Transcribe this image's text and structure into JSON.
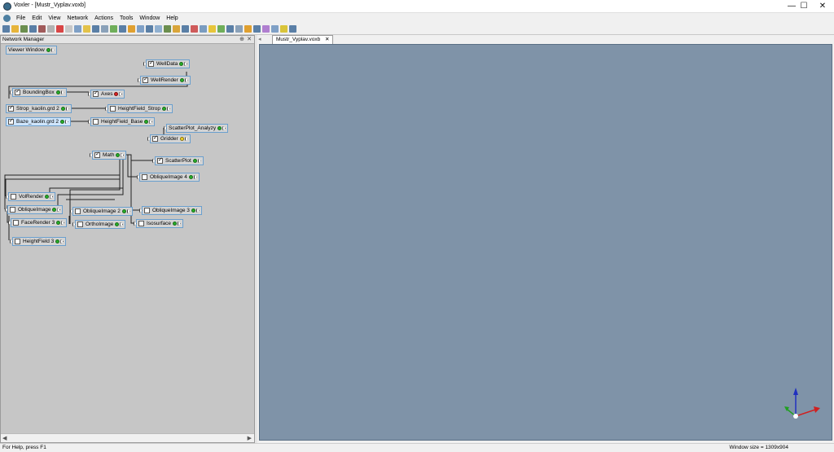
{
  "window": {
    "title": "Voxler - [Mustr_Vyplav.voxb]",
    "minimize": "—",
    "maximize": "☐",
    "close": "✕"
  },
  "menu": [
    "File",
    "Edit",
    "View",
    "Network",
    "Actions",
    "Tools",
    "Window",
    "Help"
  ],
  "toolbar_colors": [
    "#5a7fa6",
    "#e7b43a",
    "#6b8e4e",
    "#5a7fa6",
    "#a05a5a",
    "#b2b2b2",
    "#d94545",
    "#c8c8c8",
    "#7fa0c6",
    "#e3c24a",
    "#5a7fa6",
    "#8aa1b9",
    "#6fae5a",
    "#5a7fa6",
    "#e0a030",
    "#7fa0c6",
    "#5a7fa6",
    "#90b0d0",
    "#6b8e4e",
    "#d9a53a",
    "#5a7fa6",
    "#cf5b5b",
    "#7a9cc0",
    "#e7c53a",
    "#6fae5a",
    "#5a7fa6",
    "#8aa1b9",
    "#e0a030",
    "#5a7fa6",
    "#b07fd0",
    "#7fa0c6",
    "#d9c43a",
    "#5a7fa6"
  ],
  "network_manager": {
    "title": "Network Manager",
    "pin": "⊕",
    "close": "✕",
    "scroll_left": "◀",
    "scroll_right": "▶",
    "nodes": [
      {
        "id": "viewer-window",
        "label": "Viewer Window",
        "checkbox": false,
        "checked": false,
        "port": "green"
      },
      {
        "id": "welldata",
        "label": "WellData",
        "checkbox": true,
        "checked": true,
        "port": "green"
      },
      {
        "id": "wellrender",
        "label": "WellRender",
        "checkbox": true,
        "checked": true,
        "port": "green"
      },
      {
        "id": "boundingbox",
        "label": "BoundingBox",
        "checkbox": true,
        "checked": true,
        "port": "green"
      },
      {
        "id": "axes",
        "label": "Axes",
        "checkbox": true,
        "checked": true,
        "port": "red"
      },
      {
        "id": "strop-kaolin",
        "label": "Strop_kaolin.grd 2",
        "checkbox": true,
        "checked": true,
        "port": "green"
      },
      {
        "id": "heightfield-strop",
        "label": "HeightField_Strop",
        "checkbox": true,
        "checked": false,
        "port": "green"
      },
      {
        "id": "baze-kaolin",
        "label": "Baze_kaolin.grd 2",
        "checkbox": true,
        "checked": true,
        "port": "green"
      },
      {
        "id": "heightfield-base",
        "label": "HeightField_Base",
        "checkbox": true,
        "checked": false,
        "port": "green"
      },
      {
        "id": "scatterplot-analyzy",
        "label": "ScatterPlot_Analyzy",
        "checkbox": false,
        "checked": false,
        "port": "green"
      },
      {
        "id": "gridder",
        "label": "Gridder",
        "checkbox": true,
        "checked": true,
        "port": "yellow"
      },
      {
        "id": "math",
        "label": "Math",
        "checkbox": true,
        "checked": true,
        "port": "green"
      },
      {
        "id": "scatterplot",
        "label": "ScatterPlot",
        "checkbox": true,
        "checked": true,
        "port": "green"
      },
      {
        "id": "obliqueimage-4",
        "label": "ObliqueImage 4",
        "checkbox": true,
        "checked": false,
        "port": "green"
      },
      {
        "id": "volrender",
        "label": "VolRender",
        "checkbox": true,
        "checked": false,
        "port": "green"
      },
      {
        "id": "obliqueimage",
        "label": "ObliqueImage",
        "checkbox": true,
        "checked": false,
        "port": "green"
      },
      {
        "id": "obliqueimage-2",
        "label": "ObliqueImage 2",
        "checkbox": true,
        "checked": false,
        "port": "green"
      },
      {
        "id": "obliqueimage-3",
        "label": "ObliqueImage 3",
        "checkbox": true,
        "checked": false,
        "port": "green"
      },
      {
        "id": "facerender-3",
        "label": "FaceRender 3",
        "checkbox": true,
        "checked": false,
        "port": "green"
      },
      {
        "id": "orthoimage",
        "label": "OrthoImage",
        "checkbox": true,
        "checked": false,
        "port": "green"
      },
      {
        "id": "isosurface",
        "label": "Isosurface",
        "checkbox": true,
        "checked": false,
        "port": "green"
      },
      {
        "id": "heightfield-3",
        "label": "HeightField 3",
        "checkbox": true,
        "checked": false,
        "port": "green"
      }
    ]
  },
  "viewer": {
    "tab_scroll": "◂",
    "tab_label": "Mustr_Vyplav.voxb",
    "tab_close": "✕",
    "background": "#7f93a8",
    "axes_colors": {
      "x": "#d02020",
      "y": "#20a020",
      "z": "#2030c0"
    }
  },
  "status": {
    "help": "For Help, press F1",
    "window_size": "Window size = 1309x904"
  }
}
